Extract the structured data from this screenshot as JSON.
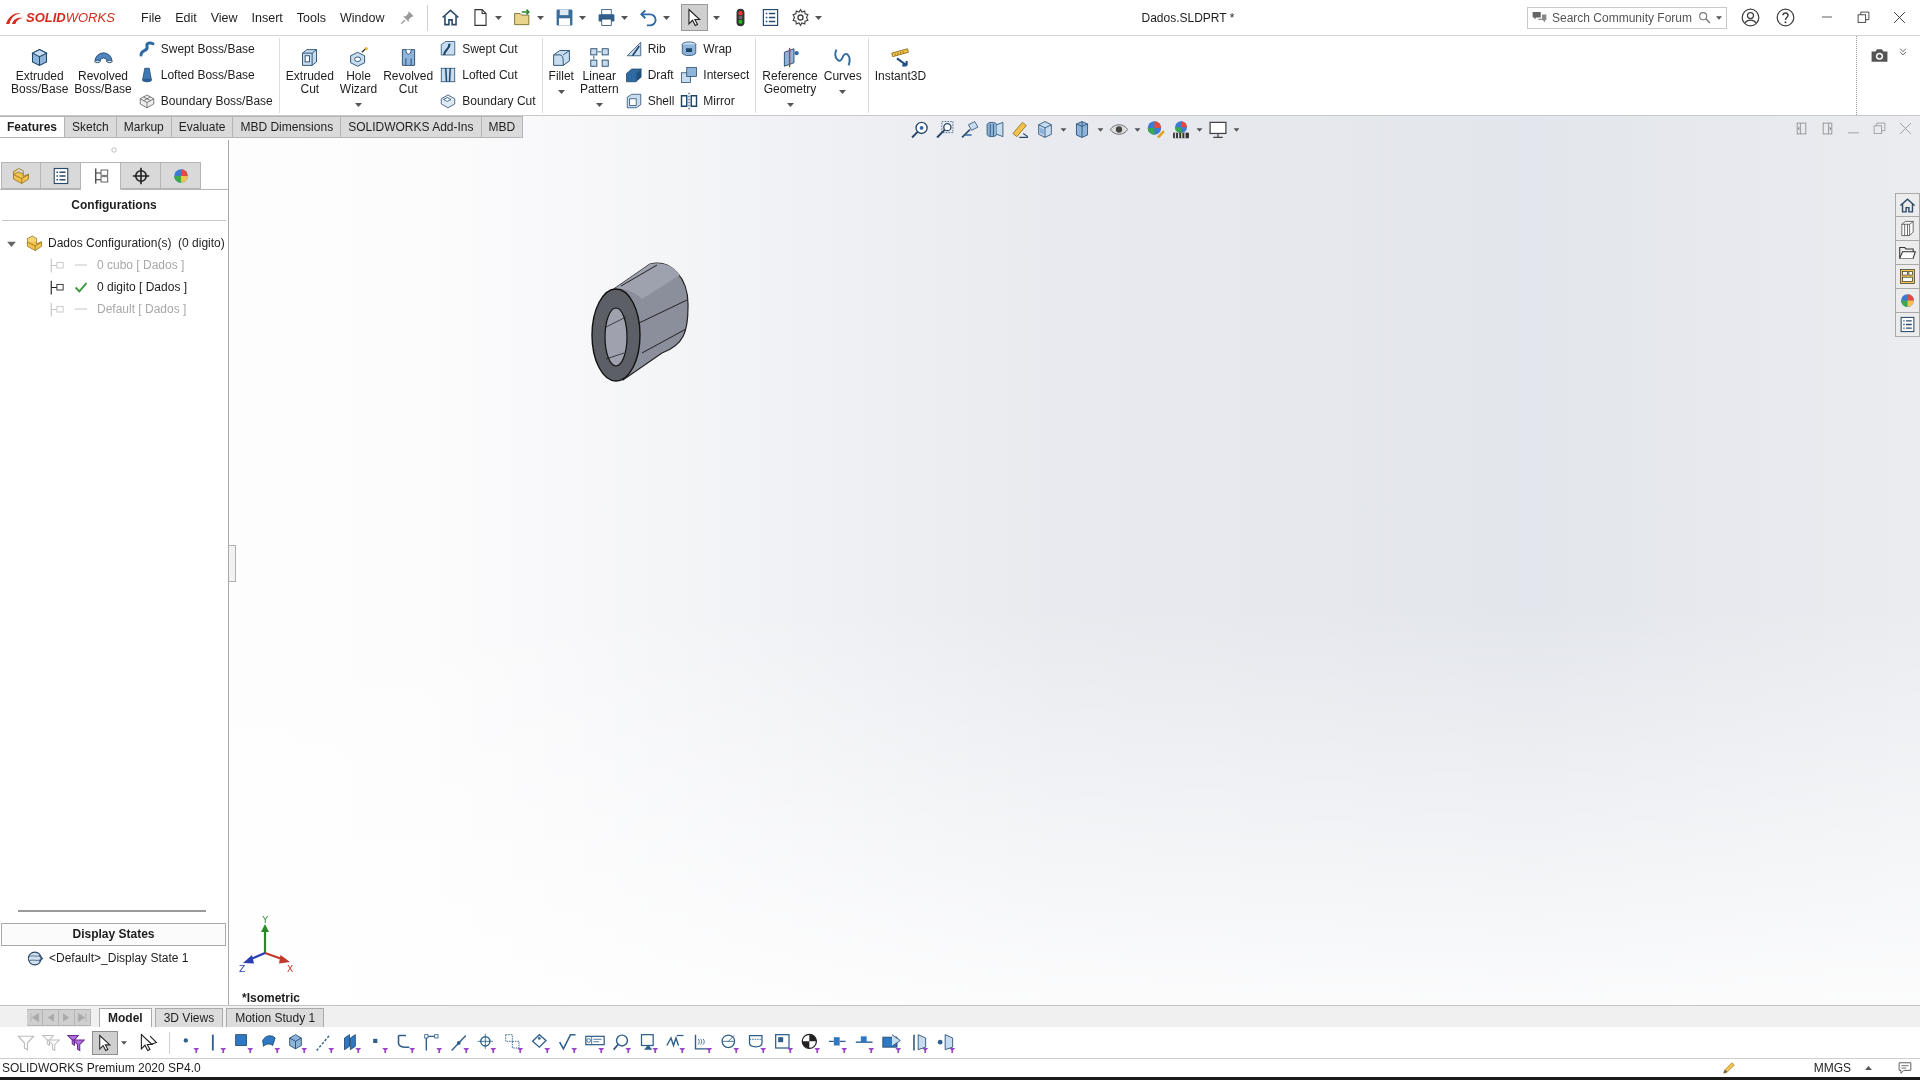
{
  "title_bar": {
    "logo": "**SOLID**WORKS",
    "menus": [
      "File",
      "Edit",
      "View",
      "Insert",
      "Tools",
      "Window"
    ],
    "quick_access": [
      {
        "pressed": false,
        "dropdown": false
      },
      {
        "pressed": false,
        "dropdown": true
      },
      {
        "pressed": false,
        "dropdown": true
      },
      {
        "pressed": false,
        "dropdown": true
      },
      {
        "pressed": false,
        "dropdown": true
      },
      {
        "pressed": false,
        "dropdown": true
      },
      {
        "pressed": true,
        "dropdown": true
      },
      {
        "pressed": false,
        "dropdown": false
      },
      {
        "pressed": false,
        "dropdown": false
      },
      {
        "pressed": false,
        "dropdown": true
      }
    ],
    "document_title": "Dados.SLDPRT *",
    "search": {
      "placeholder": "Search Community Forum"
    }
  },
  "command_manager": {
    "groups": [
      [
        {
          "kind": "large",
          "label": "Extruded Boss/Base",
          "dropdown": false
        },
        {
          "kind": "large",
          "label": "Revolved Boss/Base",
          "dropdown": false
        },
        {
          "kind": "stack",
          "entries": [
            "Swept Boss/Base",
            "Lofted Boss/Base",
            "Boundary Boss/Base"
          ]
        }
      ],
      [
        {
          "kind": "large",
          "label": "Extruded Cut",
          "dropdown": false
        },
        {
          "kind": "large",
          "label": "Hole Wizard",
          "dropdown": true
        },
        {
          "kind": "large",
          "label": "Revolved Cut",
          "dropdown": false
        },
        {
          "kind": "stack",
          "entries": [
            "Swept Cut",
            "Lofted Cut",
            "Boundary Cut"
          ]
        }
      ],
      [
        {
          "kind": "large",
          "label": "Fillet",
          "dropdown": true
        },
        {
          "kind": "large",
          "label": "Linear Pattern",
          "dropdown": true
        },
        {
          "kind": "stack",
          "entries": [
            "Rib",
            "Draft",
            "Shell"
          ]
        },
        {
          "kind": "stack",
          "entries": [
            "Wrap",
            "Intersect",
            "Mirror"
          ]
        }
      ],
      [
        {
          "kind": "large",
          "label": "Reference Geometry",
          "dropdown": true
        },
        {
          "kind": "large",
          "label": "Curves",
          "dropdown": true
        }
      ],
      [
        {
          "kind": "large",
          "label": "Instant3D",
          "dropdown": false
        }
      ]
    ],
    "tabs": [
      {
        "label": "Features",
        "selected": true
      },
      {
        "label": "Sketch",
        "selected": false
      },
      {
        "label": "Markup",
        "selected": false
      },
      {
        "label": "Evaluate",
        "selected": false
      },
      {
        "label": "MBD Dimensions",
        "selected": false
      },
      {
        "label": "SOLIDWORKS Add-Ins",
        "selected": false
      },
      {
        "label": "MBD",
        "selected": false
      }
    ]
  },
  "feature_manager": {
    "panel_tabs": [
      {
        "selected": false
      },
      {
        "selected": false
      },
      {
        "selected": true
      },
      {
        "selected": false
      },
      {
        "selected": false
      }
    ],
    "heading": "Configurations",
    "tree": [
      {
        "label": "Dados Configuration(s)  (0 digito)",
        "expanded": true,
        "children": [
          {
            "label": "0 cubo [ Dados ]",
            "active": false
          },
          {
            "label": "0 digito [ Dados ]",
            "active": true
          },
          {
            "label": "Default [ Dados ]",
            "active": false
          }
        ]
      }
    ],
    "display_states": {
      "heading": "Display States",
      "items": [
        "<Default>_Display State 1"
      ]
    }
  },
  "viewport": {
    "view_name": "*Isometric",
    "triad_labels": [
      "X",
      "Y",
      "Z"
    ]
  },
  "bottom_tabs": [
    {
      "label": "Model",
      "selected": true
    },
    {
      "label": "3D Views",
      "selected": false
    },
    {
      "label": "Motion Study 1",
      "selected": false
    }
  ],
  "selection_filter_bar": [
    {
      "disabled": true,
      "pressed": false
    },
    {
      "disabled": true,
      "pressed": false
    },
    {
      "disabled": false,
      "pressed": false
    },
    {
      "disabled": false,
      "pressed": true
    }
  ],
  "status_bar": {
    "product": "SOLIDWORKS Premium 2020 SP4.0",
    "units": "MMGS"
  }
}
